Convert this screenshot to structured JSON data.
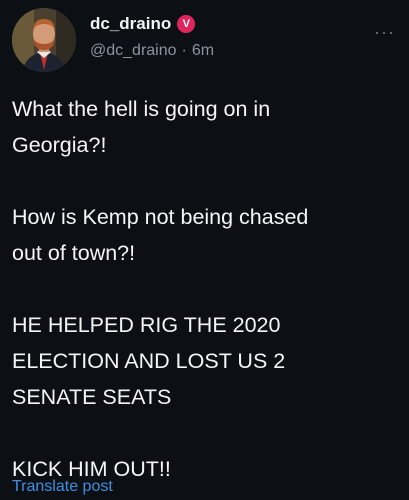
{
  "author": {
    "display_name": "dc_draino",
    "verified_badge": "V",
    "handle": "@dc_draino",
    "separator": "·",
    "timestamp": "6m"
  },
  "more_icon": "···",
  "post": {
    "paragraphs": [
      [
        "What the hell is going on in",
        "Georgia?!"
      ],
      [
        "How is Kemp not being chased",
        "out of town?!"
      ],
      [
        "HE HELPED RIG THE 2020",
        "ELECTION AND LOST US 2",
        "SENATE SEATS"
      ],
      [
        "KICK HIM OUT!!"
      ]
    ]
  },
  "translate_label": "Translate post",
  "colors": {
    "background": "#0c0f14",
    "text": "#f4f5f7",
    "secondary": "#8b95a1",
    "link": "#3f8fe0",
    "badge": "#e0245e"
  }
}
